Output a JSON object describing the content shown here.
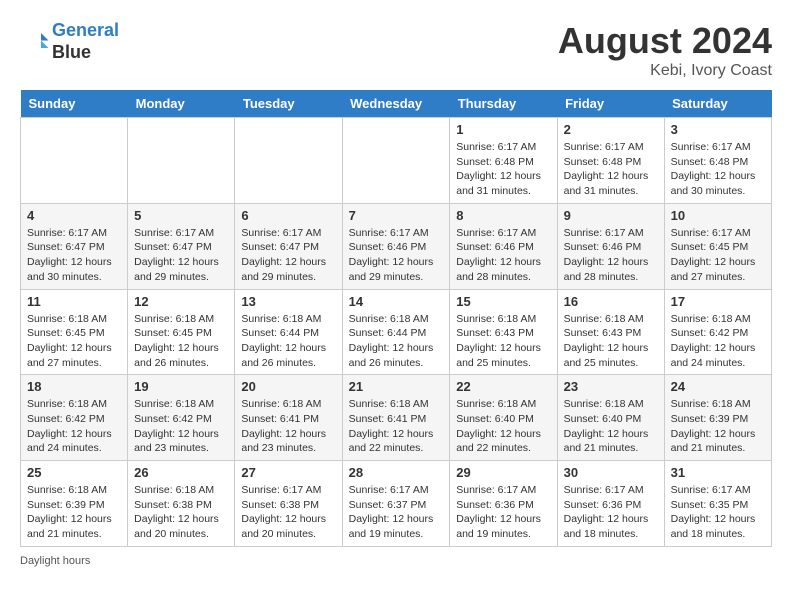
{
  "header": {
    "logo_line1": "General",
    "logo_line2": "Blue",
    "month_year": "August 2024",
    "location": "Kebi, Ivory Coast"
  },
  "days_of_week": [
    "Sunday",
    "Monday",
    "Tuesday",
    "Wednesday",
    "Thursday",
    "Friday",
    "Saturday"
  ],
  "weeks": [
    [
      {
        "day": "",
        "info": ""
      },
      {
        "day": "",
        "info": ""
      },
      {
        "day": "",
        "info": ""
      },
      {
        "day": "",
        "info": ""
      },
      {
        "day": "1",
        "info": "Sunrise: 6:17 AM\nSunset: 6:48 PM\nDaylight: 12 hours and 31 minutes."
      },
      {
        "day": "2",
        "info": "Sunrise: 6:17 AM\nSunset: 6:48 PM\nDaylight: 12 hours and 31 minutes."
      },
      {
        "day": "3",
        "info": "Sunrise: 6:17 AM\nSunset: 6:48 PM\nDaylight: 12 hours and 30 minutes."
      }
    ],
    [
      {
        "day": "4",
        "info": "Sunrise: 6:17 AM\nSunset: 6:47 PM\nDaylight: 12 hours and 30 minutes."
      },
      {
        "day": "5",
        "info": "Sunrise: 6:17 AM\nSunset: 6:47 PM\nDaylight: 12 hours and 29 minutes."
      },
      {
        "day": "6",
        "info": "Sunrise: 6:17 AM\nSunset: 6:47 PM\nDaylight: 12 hours and 29 minutes."
      },
      {
        "day": "7",
        "info": "Sunrise: 6:17 AM\nSunset: 6:46 PM\nDaylight: 12 hours and 29 minutes."
      },
      {
        "day": "8",
        "info": "Sunrise: 6:17 AM\nSunset: 6:46 PM\nDaylight: 12 hours and 28 minutes."
      },
      {
        "day": "9",
        "info": "Sunrise: 6:17 AM\nSunset: 6:46 PM\nDaylight: 12 hours and 28 minutes."
      },
      {
        "day": "10",
        "info": "Sunrise: 6:17 AM\nSunset: 6:45 PM\nDaylight: 12 hours and 27 minutes."
      }
    ],
    [
      {
        "day": "11",
        "info": "Sunrise: 6:18 AM\nSunset: 6:45 PM\nDaylight: 12 hours and 27 minutes."
      },
      {
        "day": "12",
        "info": "Sunrise: 6:18 AM\nSunset: 6:45 PM\nDaylight: 12 hours and 26 minutes."
      },
      {
        "day": "13",
        "info": "Sunrise: 6:18 AM\nSunset: 6:44 PM\nDaylight: 12 hours and 26 minutes."
      },
      {
        "day": "14",
        "info": "Sunrise: 6:18 AM\nSunset: 6:44 PM\nDaylight: 12 hours and 26 minutes."
      },
      {
        "day": "15",
        "info": "Sunrise: 6:18 AM\nSunset: 6:43 PM\nDaylight: 12 hours and 25 minutes."
      },
      {
        "day": "16",
        "info": "Sunrise: 6:18 AM\nSunset: 6:43 PM\nDaylight: 12 hours and 25 minutes."
      },
      {
        "day": "17",
        "info": "Sunrise: 6:18 AM\nSunset: 6:42 PM\nDaylight: 12 hours and 24 minutes."
      }
    ],
    [
      {
        "day": "18",
        "info": "Sunrise: 6:18 AM\nSunset: 6:42 PM\nDaylight: 12 hours and 24 minutes."
      },
      {
        "day": "19",
        "info": "Sunrise: 6:18 AM\nSunset: 6:42 PM\nDaylight: 12 hours and 23 minutes."
      },
      {
        "day": "20",
        "info": "Sunrise: 6:18 AM\nSunset: 6:41 PM\nDaylight: 12 hours and 23 minutes."
      },
      {
        "day": "21",
        "info": "Sunrise: 6:18 AM\nSunset: 6:41 PM\nDaylight: 12 hours and 22 minutes."
      },
      {
        "day": "22",
        "info": "Sunrise: 6:18 AM\nSunset: 6:40 PM\nDaylight: 12 hours and 22 minutes."
      },
      {
        "day": "23",
        "info": "Sunrise: 6:18 AM\nSunset: 6:40 PM\nDaylight: 12 hours and 21 minutes."
      },
      {
        "day": "24",
        "info": "Sunrise: 6:18 AM\nSunset: 6:39 PM\nDaylight: 12 hours and 21 minutes."
      }
    ],
    [
      {
        "day": "25",
        "info": "Sunrise: 6:18 AM\nSunset: 6:39 PM\nDaylight: 12 hours and 21 minutes."
      },
      {
        "day": "26",
        "info": "Sunrise: 6:18 AM\nSunset: 6:38 PM\nDaylight: 12 hours and 20 minutes."
      },
      {
        "day": "27",
        "info": "Sunrise: 6:17 AM\nSunset: 6:38 PM\nDaylight: 12 hours and 20 minutes."
      },
      {
        "day": "28",
        "info": "Sunrise: 6:17 AM\nSunset: 6:37 PM\nDaylight: 12 hours and 19 minutes."
      },
      {
        "day": "29",
        "info": "Sunrise: 6:17 AM\nSunset: 6:36 PM\nDaylight: 12 hours and 19 minutes."
      },
      {
        "day": "30",
        "info": "Sunrise: 6:17 AM\nSunset: 6:36 PM\nDaylight: 12 hours and 18 minutes."
      },
      {
        "day": "31",
        "info": "Sunrise: 6:17 AM\nSunset: 6:35 PM\nDaylight: 12 hours and 18 minutes."
      }
    ]
  ],
  "footer": {
    "daylight_label": "Daylight hours"
  }
}
